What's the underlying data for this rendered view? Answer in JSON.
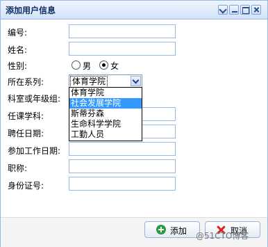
{
  "window": {
    "title": "添加用户信息",
    "controls": [
      "collapse-icon",
      "minimize-icon",
      "maximize-icon",
      "close-icon"
    ]
  },
  "form": {
    "id_label": "编号:",
    "name_label": "姓名:",
    "gender_label": "性别:",
    "gender_options": [
      "男",
      "女"
    ],
    "gender_selected": "女",
    "dept_label": "所在系列:",
    "dept_selected": "体育学院",
    "dept_options": [
      "体育学院",
      "社会发展学院",
      "斯蒂芬森",
      "生命科学学院",
      "工勤人员"
    ],
    "dept_highlighted": "社会发展学院",
    "office_label": "科室或年级组:",
    "subject_label": "任课学科:",
    "hire_date_label": "聘任日期:",
    "work_date_label": "参加工作日期:",
    "title_label": "职称:",
    "idcard_label": "身份证号:"
  },
  "footer": {
    "add_label": "添加",
    "cancel_label": "取消"
  },
  "watermark": "@51CTO博客",
  "colors": {
    "border": "#95b8e7",
    "highlight": "#3399ff",
    "add_icon": "#2e9b3a",
    "cancel_icon": "#dd2222"
  }
}
